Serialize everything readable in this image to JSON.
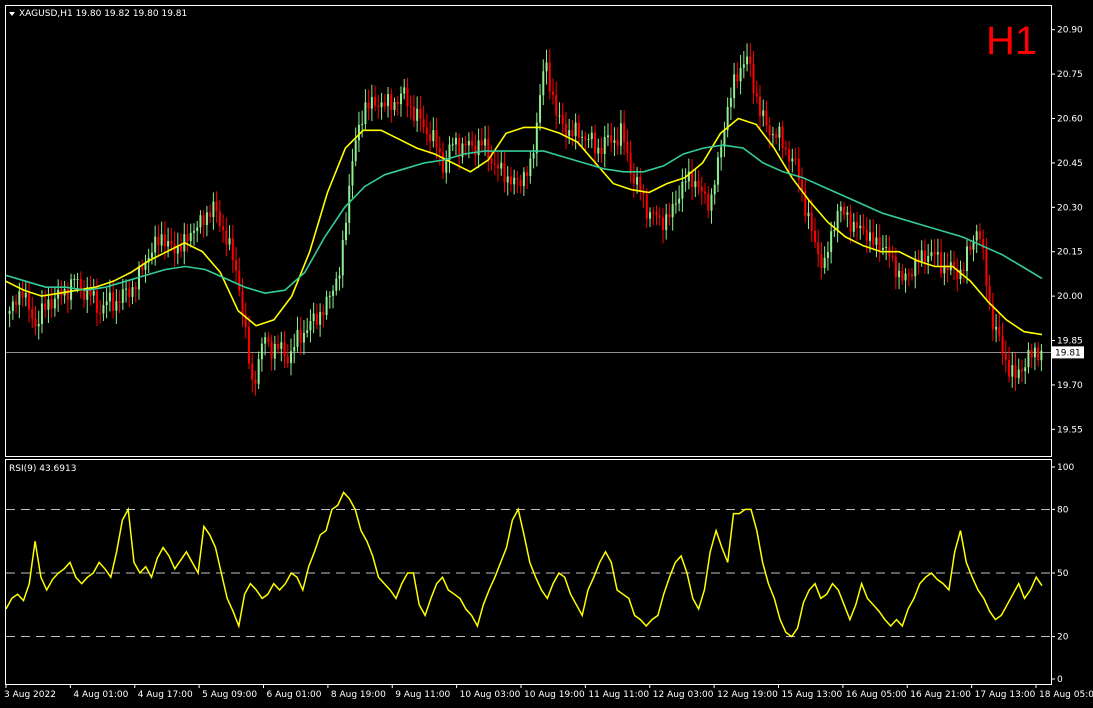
{
  "chart_data": [
    {
      "type": "candlestick",
      "title": "XAGUSD,H1  19.80 19.82 19.80 19.81",
      "timeframe_badge": "H1",
      "symbol": "XAGUSD",
      "period": "H1",
      "last_price": "19.81",
      "ylim": [
        19.46,
        20.98
      ],
      "yticks": [
        "20.90",
        "20.75",
        "20.60",
        "20.45",
        "20.30",
        "20.15",
        "20.00",
        "19.85",
        "19.70",
        "19.55"
      ],
      "ytick_values": [
        20.9,
        20.75,
        20.6,
        20.45,
        20.3,
        20.15,
        20.0,
        19.85,
        19.7,
        19.55
      ],
      "xticks": [
        "3 Aug 2022",
        "4 Aug 01:00",
        "4 Aug 17:00",
        "5 Aug 09:00",
        "6 Aug 01:00",
        "8 Aug 19:00",
        "9 Aug 11:00",
        "10 Aug 03:00",
        "10 Aug 19:00",
        "11 Aug 11:00",
        "12 Aug 03:00",
        "12 Aug 19:00",
        "15 Aug 13:00",
        "16 Aug 05:00",
        "16 Aug 21:00",
        "17 Aug 13:00",
        "18 Aug 05:00"
      ],
      "up_color": "#90ee90",
      "down_color": "#ff0000",
      "background": "#000000",
      "close_anchors": [
        19.95,
        20.02,
        19.9,
        19.98,
        20.0,
        20.05,
        20.02,
        19.96,
        19.98,
        20.0,
        20.05,
        20.15,
        20.2,
        20.15,
        20.2,
        20.25,
        20.3,
        20.2,
        20.05,
        19.7,
        19.85,
        19.82,
        19.8,
        19.88,
        19.92,
        19.98,
        20.1,
        20.5,
        20.65,
        20.65,
        20.65,
        20.68,
        20.6,
        20.55,
        20.45,
        20.52,
        20.5,
        20.52,
        20.45,
        20.4,
        20.38,
        20.45,
        20.8,
        20.6,
        20.55,
        20.55,
        20.5,
        20.52,
        20.55,
        20.4,
        20.3,
        20.25,
        20.28,
        20.4,
        20.38,
        20.3,
        20.55,
        20.75,
        20.8,
        20.6,
        20.55,
        20.5,
        20.4,
        20.2,
        20.1,
        20.3,
        20.25,
        20.22,
        20.18,
        20.15,
        20.05,
        20.1,
        20.15,
        20.12,
        20.08,
        20.1,
        20.25,
        19.95,
        19.8,
        19.72,
        19.8,
        19.81
      ],
      "ma_fast": {
        "color": "#ffff00",
        "values": [
          20.05,
          20.02,
          20.0,
          20.01,
          20.02,
          20.03,
          20.05,
          20.08,
          20.12,
          20.15,
          20.18,
          20.15,
          20.08,
          19.95,
          19.9,
          19.92,
          20.0,
          20.15,
          20.35,
          20.5,
          20.56,
          20.56,
          20.53,
          20.5,
          20.48,
          20.45,
          20.42,
          20.46,
          20.55,
          20.57,
          20.57,
          20.55,
          20.52,
          20.45,
          20.38,
          20.36,
          20.35,
          20.38,
          20.4,
          20.45,
          20.55,
          20.6,
          20.58,
          20.5,
          20.4,
          20.32,
          20.25,
          20.2,
          20.17,
          20.15,
          20.15,
          20.12,
          20.1,
          20.1,
          20.05,
          19.98,
          19.92,
          19.88,
          19.87
        ]
      },
      "ma_slow": {
        "color": "#33cc99",
        "values": [
          20.07,
          20.05,
          20.03,
          20.03,
          20.02,
          20.03,
          20.05,
          20.07,
          20.09,
          20.1,
          20.09,
          20.06,
          20.03,
          20.01,
          20.02,
          20.08,
          20.2,
          20.3,
          20.37,
          20.41,
          20.43,
          20.45,
          20.46,
          20.48,
          20.49,
          20.49,
          20.49,
          20.49,
          20.47,
          20.45,
          20.43,
          20.42,
          20.42,
          20.44,
          20.48,
          20.5,
          20.51,
          20.5,
          20.45,
          20.42,
          20.4,
          20.37,
          20.34,
          20.31,
          20.28,
          20.26,
          20.24,
          20.22,
          20.2,
          20.17,
          20.14,
          20.1,
          20.06
        ]
      }
    },
    {
      "type": "line",
      "title": "RSI(9) 43.6913",
      "indicator": "RSI(9)",
      "value": "43.6913",
      "ylim": [
        0,
        100
      ],
      "yticks": [
        "100",
        "80",
        "50",
        "20",
        "0"
      ],
      "ytick_values": [
        100,
        80,
        50,
        20,
        0
      ],
      "levels": [
        80,
        50,
        20
      ],
      "line_color": "#ffff00",
      "values": [
        33,
        38,
        40,
        37,
        45,
        65,
        48,
        42,
        47,
        50,
        52,
        55,
        48,
        45,
        48,
        50,
        55,
        52,
        48,
        60,
        75,
        80,
        55,
        50,
        53,
        48,
        57,
        62,
        58,
        52,
        56,
        60,
        55,
        50,
        72,
        68,
        62,
        50,
        38,
        32,
        25,
        40,
        45,
        42,
        38,
        40,
        45,
        42,
        45,
        50,
        48,
        42,
        53,
        60,
        68,
        70,
        80,
        82,
        88,
        85,
        80,
        70,
        65,
        58,
        48,
        45,
        42,
        38,
        45,
        50,
        50,
        35,
        30,
        38,
        45,
        48,
        42,
        40,
        38,
        33,
        30,
        25,
        35,
        42,
        48,
        55,
        62,
        75,
        80,
        68,
        55,
        48,
        42,
        38,
        45,
        50,
        48,
        40,
        35,
        30,
        42,
        48,
        55,
        60,
        55,
        42,
        40,
        38,
        30,
        28,
        25,
        28,
        30,
        40,
        48,
        55,
        58,
        50,
        38,
        33,
        42,
        60,
        70,
        62,
        55,
        78,
        78,
        80,
        80,
        70,
        55,
        45,
        38,
        28,
        22,
        20,
        24,
        36,
        42,
        45,
        38,
        40,
        45,
        42,
        35,
        28,
        35,
        45,
        38,
        35,
        32,
        28,
        25,
        28,
        25,
        33,
        38,
        45,
        48,
        50,
        47,
        45,
        42,
        60,
        70,
        55,
        48,
        42,
        38,
        32,
        28,
        30,
        35,
        40,
        45,
        38,
        42,
        48,
        44
      ]
    }
  ]
}
